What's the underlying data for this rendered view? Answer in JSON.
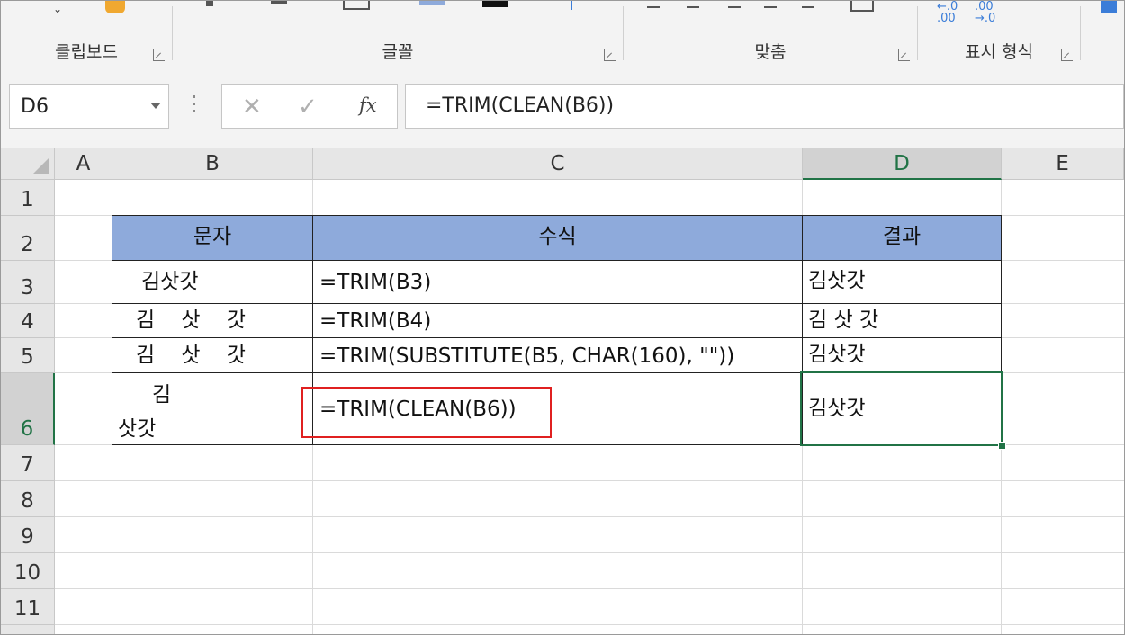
{
  "ribbon": {
    "groups": [
      {
        "label": "클립보드"
      },
      {
        "label": "글꼴"
      },
      {
        "label": "맞춤"
      },
      {
        "label": "표시 형식"
      }
    ],
    "decrease_decimal_label": "←.0\n.00",
    "increase_decimal_label": ".00\n→.0"
  },
  "formula_bar": {
    "name_box": "D6",
    "cancel_glyph": "✕",
    "enter_glyph": "✓",
    "fx_label": "fx",
    "formula": "=TRIM(CLEAN(B6))"
  },
  "sheet": {
    "columns": [
      "A",
      "B",
      "C",
      "D",
      "E"
    ],
    "selected_column": "D",
    "rows": [
      "1",
      "2",
      "3",
      "4",
      "5",
      "6",
      "7",
      "8",
      "9",
      "10",
      "11"
    ],
    "selected_row": "6",
    "table": {
      "headers": [
        "문자",
        "수식",
        "결과"
      ],
      "rows": [
        {
          "text": "김삿갓",
          "formula": "=TRIM(B3)",
          "result": "김삿갓"
        },
        {
          "text": "김    삿    갓",
          "formula": "=TRIM(B4)",
          "result": "김 삿 갓"
        },
        {
          "text": "김    삿    갓",
          "formula": "=TRIM(SUBSTITUTE(B5, CHAR(160), \"\"))",
          "result": "김삿갓"
        },
        {
          "text_line1": "김",
          "text_line2": "삿갓",
          "formula": "=TRIM(CLEAN(B6))",
          "result": "김삿갓"
        }
      ]
    },
    "colors": {
      "header_fill": "#8eaadb",
      "selection": "#217346",
      "highlight": "#e02020"
    }
  }
}
